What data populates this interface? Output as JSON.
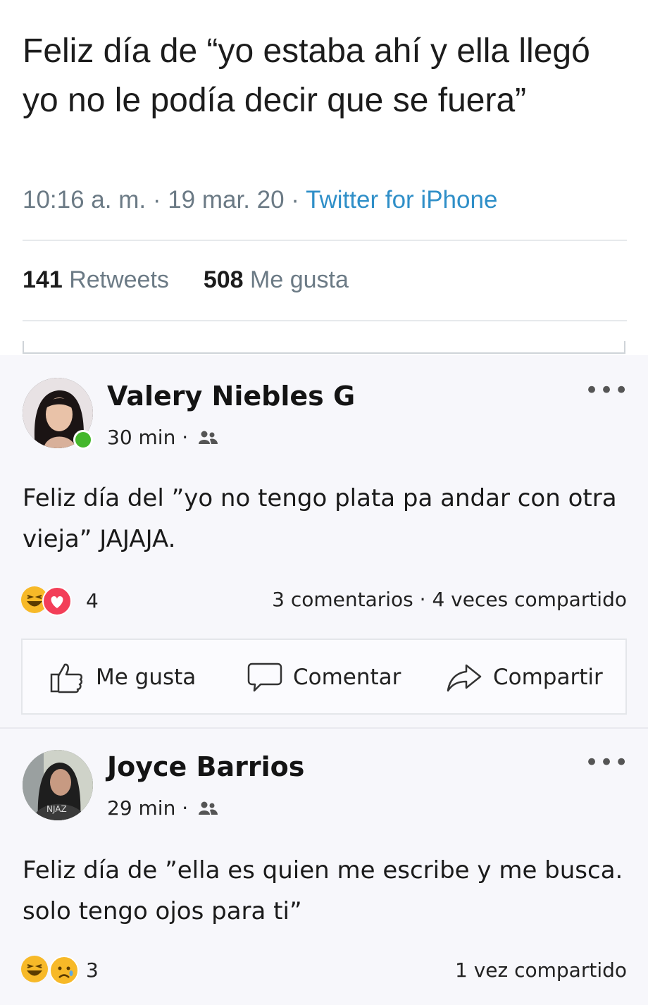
{
  "tweet": {
    "text": "Feliz día de “yo estaba ahí y ella llegó yo no le podía decir que se fuera”",
    "time": "10:16 a. m. · 19 mar. 20 ·",
    "source": "Twitter for iPhone",
    "retweets_count": "141",
    "retweets_label": "Retweets",
    "likes_count": "508",
    "likes_label": "Me gusta"
  },
  "posts": [
    {
      "author": "Valery Niebles G",
      "time": "30 min ·",
      "text": "Feliz día del ”yo no tengo plata pa andar con otra vieja” JAJAJA.",
      "reaction_count": "4",
      "counts": "3 comentarios · 4 veces compartido",
      "more": "•••"
    },
    {
      "author": "Joyce Barrios",
      "time": "29 min ·",
      "text": "Feliz día de ”ella es quien me escribe y me busca. solo tengo ojos para ti”",
      "reaction_count": "3",
      "counts": "1 vez compartido",
      "more": "•••"
    }
  ],
  "actions": {
    "like": "Me gusta",
    "comment": "Comentar",
    "share": "Compartir"
  },
  "icons": {
    "friends": "friends-icon",
    "like": "thumbs-up-icon",
    "comment": "speech-bubble-icon",
    "share": "share-arrow-icon",
    "haha": "haha-emoji-icon",
    "love": "heart-icon",
    "sad": "sad-emoji-icon"
  },
  "colors": {
    "link": "#2f8fc8",
    "online": "#44b72c",
    "love": "#f33e58",
    "haha": "#f7b928"
  }
}
